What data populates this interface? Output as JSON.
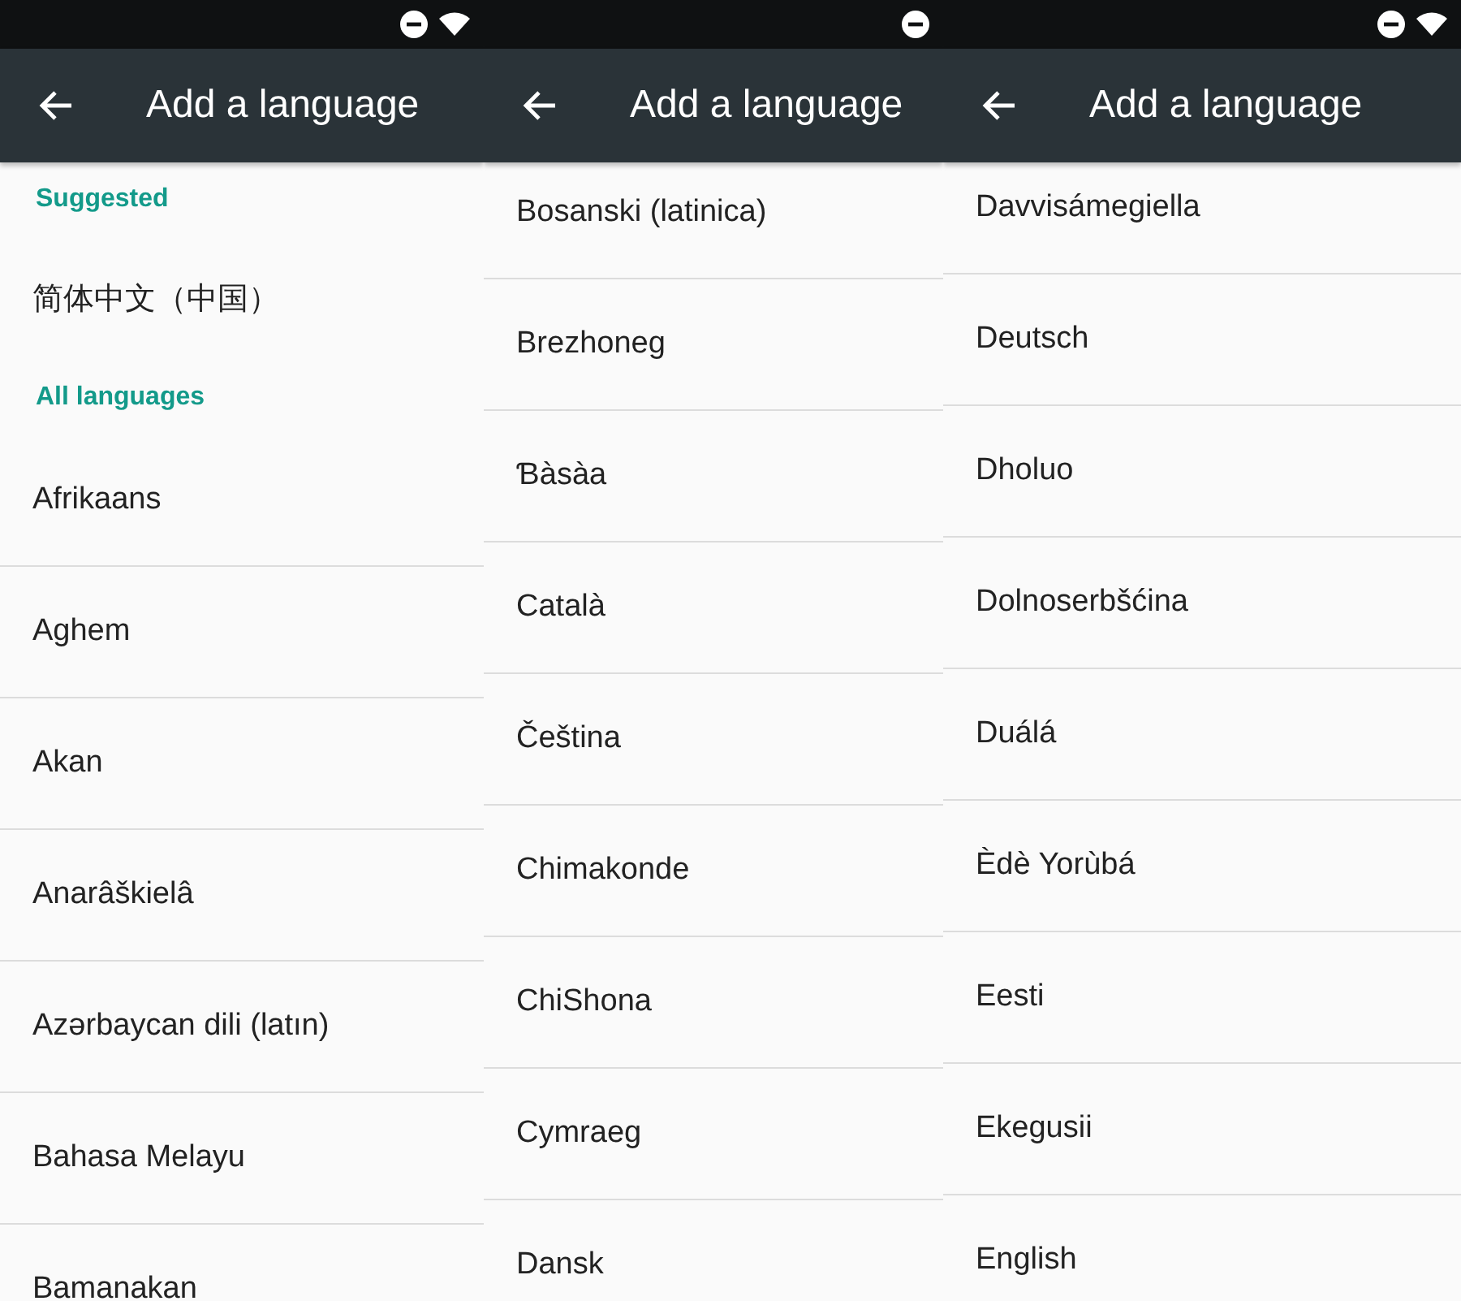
{
  "panels": [
    {
      "status_bar": {
        "icons": [
          {
            "kind": "dnd"
          },
          {
            "kind": "wifi"
          }
        ]
      },
      "app_bar": {
        "title": "Add a language"
      },
      "items": [
        {
          "kind": "header",
          "label": "Suggested"
        },
        {
          "kind": "suggested",
          "label": "简体中文（中国）"
        },
        {
          "kind": "header",
          "label": "All languages"
        },
        {
          "kind": "language",
          "label": "Afrikaans"
        },
        {
          "kind": "language",
          "label": "Aghem"
        },
        {
          "kind": "language",
          "label": "Akan"
        },
        {
          "kind": "language",
          "label": "Anarâškielâ"
        },
        {
          "kind": "language",
          "label": "Azərbaycan dili (latın)"
        },
        {
          "kind": "language",
          "label": "Bahasa Melayu"
        },
        {
          "kind": "language",
          "label": "Bamanakan"
        }
      ]
    },
    {
      "status_bar": {
        "icons": [
          {
            "kind": "dnd"
          }
        ]
      },
      "app_bar": {
        "title": "Add a language"
      },
      "items": [
        {
          "kind": "language",
          "label": "Bosanski (latinica)"
        },
        {
          "kind": "language",
          "label": "Brezhoneg"
        },
        {
          "kind": "language",
          "label": "Ɓàsàa"
        },
        {
          "kind": "language",
          "label": "Català"
        },
        {
          "kind": "language",
          "label": "Čeština"
        },
        {
          "kind": "language",
          "label": "Chimakonde"
        },
        {
          "kind": "language",
          "label": "ChiShona"
        },
        {
          "kind": "language",
          "label": "Cymraeg"
        },
        {
          "kind": "language",
          "label": "Dansk"
        }
      ]
    },
    {
      "status_bar": {
        "icons": [
          {
            "kind": "dnd"
          },
          {
            "kind": "wifi"
          }
        ]
      },
      "app_bar": {
        "title": "Add a language"
      },
      "items": [
        {
          "kind": "language",
          "label": "Davvisámegiella"
        },
        {
          "kind": "language",
          "label": "Deutsch"
        },
        {
          "kind": "language",
          "label": "Dholuo"
        },
        {
          "kind": "language",
          "label": "Dolnoserbšćina"
        },
        {
          "kind": "language",
          "label": "Duálá"
        },
        {
          "kind": "language",
          "label": "Èdè Yorùbá"
        },
        {
          "kind": "language",
          "label": "Eesti"
        },
        {
          "kind": "language",
          "label": "Ekegusii"
        },
        {
          "kind": "language",
          "label": "English"
        }
      ]
    }
  ]
}
